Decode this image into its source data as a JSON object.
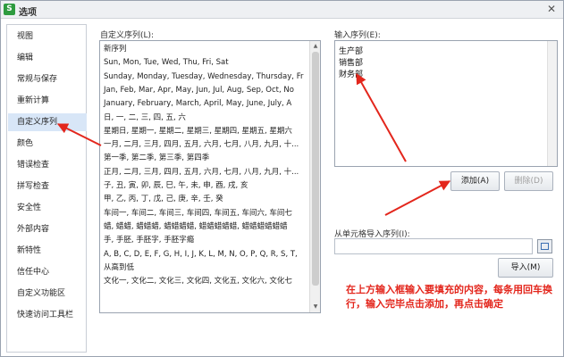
{
  "window": {
    "title": "选项",
    "app_icon_glyph": "S",
    "close_glyph": "✕"
  },
  "sidebar": {
    "items": [
      {
        "label": "视图"
      },
      {
        "label": "编辑"
      },
      {
        "label": "常规与保存"
      },
      {
        "label": "重新计算"
      },
      {
        "label": "自定义序列",
        "selected": true
      },
      {
        "label": "颜色"
      },
      {
        "label": "错误检查"
      },
      {
        "label": "拼写检查"
      },
      {
        "label": "安全性"
      },
      {
        "label": "外部内容"
      },
      {
        "label": "新特性"
      },
      {
        "label": "信任中心"
      },
      {
        "label": "自定义功能区"
      },
      {
        "label": "快速访问工具栏"
      }
    ]
  },
  "custom_lists": {
    "label": "自定义序列(L):",
    "items": [
      "新序列",
      "Sun, Mon, Tue, Wed, Thu, Fri, Sat",
      "Sunday, Monday, Tuesday, Wednesday, Thursday, Fr",
      "Jan, Feb, Mar, Apr, May, Jun, Jul, Aug, Sep, Oct, No",
      "January, February, March, April, May, June, July, A",
      "日, 一, 二, 三, 四, 五, 六",
      "星期日, 星期一, 星期二, 星期三, 星期四, 星期五, 星期六",
      "一月, 二月, 三月, 四月, 五月, 六月, 七月, 八月, 九月, 十...",
      "第一季, 第二季, 第三季, 第四季",
      "正月, 二月, 三月, 四月, 五月, 六月, 七月, 八月, 九月, 十...",
      "子, 丑, 寅, 卯, 辰, 巳, 午, 未, 申, 酉, 戌, 亥",
      "甲, 乙, 丙, 丁, 戊, 己, 庚, 辛, 壬, 癸",
      "车间一, 车间二, 车间三, 车间四, 车间五, 车间六, 车间七",
      "蜡, 蜡蜡, 蜡蜡蜡, 蜡蜡蜡蜡, 蜡蜡蜡蜡蜡, 蜡蜡蜡蜡蜡蜡",
      "手, 手胚, 手胚字, 手胚字瘾",
      "A, B, C, D, E, F, G, H, I, J, K, L, M, N, O, P, Q, R, S, T,",
      "从高到低",
      "文化一, 文化二, 文化三, 文化四, 文化五, 文化六, 文化七"
    ]
  },
  "entries": {
    "label": "输入序列(E):",
    "lines": [
      "生产部",
      "销售部",
      "财务部"
    ]
  },
  "buttons": {
    "add": "添加(A)",
    "delete": "删除(D)",
    "import": "导入(M)"
  },
  "import_range": {
    "label": "从单元格导入序列(I):",
    "value": ""
  },
  "annotation": {
    "text": "在上方输入框输入要填充的内容，每条用回车换行，输入完毕点击添加，再点击确定",
    "color": "#e3261c"
  },
  "colors": {
    "selection": "#d8e6f7",
    "annotation_red": "#e3261c",
    "app_green": "#2e9b3f"
  },
  "icons": [
    "app-icon",
    "close-icon",
    "scroll-up-icon",
    "scroll-down-icon",
    "collapse-dialog-icon"
  ]
}
